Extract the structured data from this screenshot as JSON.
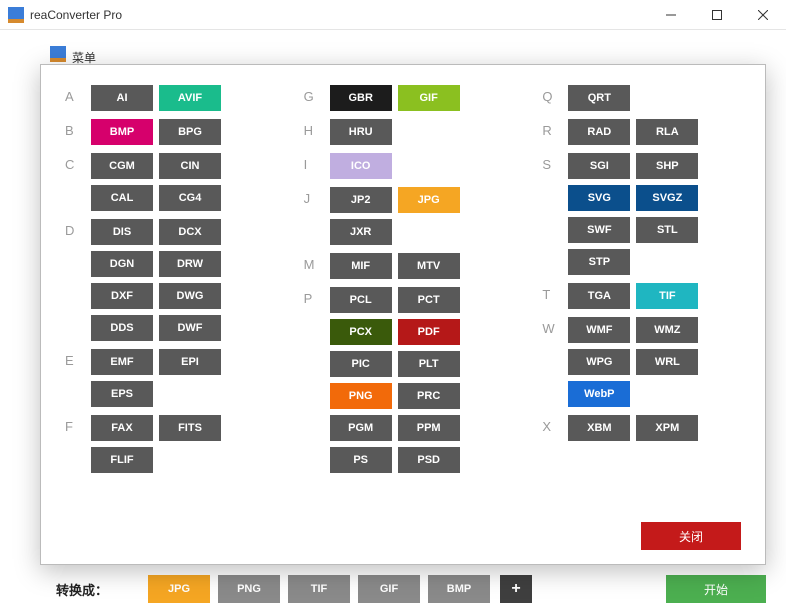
{
  "window": {
    "title": "reaConverter Pro"
  },
  "menu": {
    "label": "菜单"
  },
  "chart_data": null,
  "columns": [
    [
      {
        "letter": "A",
        "fmts": [
          {
            "t": "AI"
          },
          {
            "t": "AVIF",
            "c": "#1abc8c"
          }
        ]
      },
      {
        "letter": "B",
        "fmts": [
          {
            "t": "BMP",
            "c": "#d6006c"
          },
          {
            "t": "BPG"
          }
        ]
      },
      {
        "letter": "C",
        "fmts": [
          {
            "t": "CGM"
          },
          {
            "t": "CIN"
          },
          {
            "t": "CAL"
          },
          {
            "t": "CG4"
          }
        ]
      },
      {
        "letter": "D",
        "fmts": [
          {
            "t": "DIS"
          },
          {
            "t": "DCX"
          },
          {
            "t": "DGN"
          },
          {
            "t": "DRW"
          },
          {
            "t": "DXF"
          },
          {
            "t": "DWG"
          },
          {
            "t": "DDS"
          },
          {
            "t": "DWF"
          }
        ]
      },
      {
        "letter": "E",
        "fmts": [
          {
            "t": "EMF"
          },
          {
            "t": "EPI"
          },
          {
            "t": "EPS"
          }
        ]
      },
      {
        "letter": "F",
        "fmts": [
          {
            "t": "FAX"
          },
          {
            "t": "FITS"
          },
          {
            "t": "FLIF"
          }
        ]
      }
    ],
    [
      {
        "letter": "G",
        "fmts": [
          {
            "t": "GBR",
            "c": "#1c1c1c"
          },
          {
            "t": "GIF",
            "c": "#8bc020"
          }
        ]
      },
      {
        "letter": "H",
        "fmts": [
          {
            "t": "HRU"
          }
        ]
      },
      {
        "letter": "I",
        "fmts": [
          {
            "t": "ICO",
            "c": "#c0aee0"
          }
        ]
      },
      {
        "letter": "J",
        "fmts": [
          {
            "t": "JP2"
          },
          {
            "t": "JPG",
            "c": "#f5a623"
          },
          {
            "t": "JXR"
          }
        ]
      },
      {
        "letter": "M",
        "fmts": [
          {
            "t": "MIF"
          },
          {
            "t": "MTV"
          }
        ]
      },
      {
        "letter": "P",
        "fmts": [
          {
            "t": "PCL"
          },
          {
            "t": "PCT"
          },
          {
            "t": "PCX",
            "c": "#3a5a0b"
          },
          {
            "t": "PDF",
            "c": "#b51818"
          },
          {
            "t": "PIC"
          },
          {
            "t": "PLT"
          },
          {
            "t": "PNG",
            "c": "#f26a0a"
          },
          {
            "t": "PRC"
          },
          {
            "t": "PGM"
          },
          {
            "t": "PPM"
          },
          {
            "t": "PS"
          },
          {
            "t": "PSD"
          }
        ]
      }
    ],
    [
      {
        "letter": "Q",
        "fmts": [
          {
            "t": "QRT"
          }
        ]
      },
      {
        "letter": "R",
        "fmts": [
          {
            "t": "RAD"
          },
          {
            "t": "RLA"
          }
        ]
      },
      {
        "letter": "S",
        "fmts": [
          {
            "t": "SGI"
          },
          {
            "t": "SHP"
          },
          {
            "t": "SVG",
            "c": "#0b4f8c"
          },
          {
            "t": "SVGZ",
            "c": "#0b4f8c"
          },
          {
            "t": "SWF"
          },
          {
            "t": "STL"
          },
          {
            "t": "STP"
          }
        ]
      },
      {
        "letter": "T",
        "fmts": [
          {
            "t": "TGA"
          },
          {
            "t": "TIF",
            "c": "#1fb6c1"
          }
        ]
      },
      {
        "letter": "W",
        "fmts": [
          {
            "t": "WMF"
          },
          {
            "t": "WMZ"
          },
          {
            "t": "WPG"
          },
          {
            "t": "WRL"
          },
          {
            "t": "WebP",
            "c": "#1a6dd6"
          }
        ]
      },
      {
        "letter": "X",
        "fmts": [
          {
            "t": "XBM"
          },
          {
            "t": "XPM"
          }
        ]
      }
    ]
  ],
  "close_label": "关闭",
  "bottom": {
    "label": "转换成：",
    "formats": [
      {
        "t": "JPG",
        "c": "#f5a623"
      },
      {
        "t": "PNG",
        "c": "#8a8a8a"
      },
      {
        "t": "TIF",
        "c": "#8a8a8a"
      },
      {
        "t": "GIF",
        "c": "#8a8a8a"
      },
      {
        "t": "BMP",
        "c": "#8a8a8a"
      }
    ],
    "plus": "+",
    "start": "开始"
  }
}
